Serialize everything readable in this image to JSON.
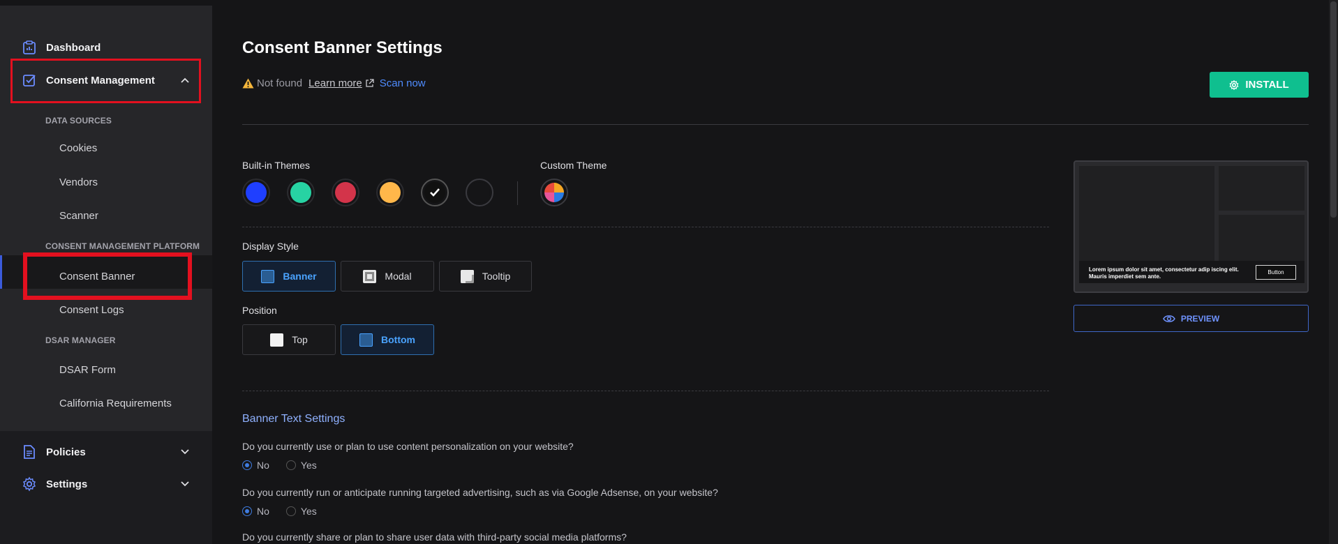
{
  "sidebar": {
    "dashboard": "Dashboard",
    "consent_management": "Consent Management",
    "data_sources_label": "DATA SOURCES",
    "cookies": "Cookies",
    "vendors": "Vendors",
    "scanner": "Scanner",
    "cmp_label": "CONSENT MANAGEMENT PLATFORM",
    "consent_banner": "Consent Banner",
    "consent_logs": "Consent Logs",
    "dsar_label": "DSAR MANAGER",
    "dsar_form": "DSAR Form",
    "california": "California Requirements",
    "policies": "Policies",
    "settings": "Settings"
  },
  "main": {
    "title": "Consent Banner Settings",
    "status_not_found": "Not found",
    "learn_more": "Learn more",
    "scan_now": "Scan now",
    "install": "INSTALL",
    "builtin_themes": "Built-in Themes",
    "custom_theme": "Custom Theme",
    "theme_colors": [
      "#1f3fff",
      "#27d3a3",
      "#d3344a",
      "#ffb74a",
      "#111111",
      "#151517"
    ],
    "display_style_label": "Display Style",
    "display_styles": [
      "Banner",
      "Modal",
      "Tooltip"
    ],
    "selected_display_style": "Banner",
    "position_label": "Position",
    "positions": [
      "Top",
      "Bottom"
    ],
    "selected_position": "Bottom",
    "preview_text": "Lorem ipsum dolor sit amet, consectetur adip iscing elit. Mauris imperdiet sem ante.",
    "preview_button": "Button",
    "preview_action": "PREVIEW",
    "banner_text_settings": "Banner Text Settings",
    "questions": [
      {
        "text": "Do you currently use or plan to use content personalization on your website?",
        "no": "No",
        "yes": "Yes",
        "selected": "No"
      },
      {
        "text": "Do you currently run or anticipate running targeted advertising, such as via Google Adsense, on your website?",
        "no": "No",
        "yes": "Yes",
        "selected": "No"
      },
      {
        "text": "Do you currently share or plan to share user data with third-party social media platforms?"
      }
    ]
  },
  "colors": {
    "accent_green": "#0fbf8f",
    "accent_blue": "#4aa3ff",
    "highlight_red": "#e3101f"
  }
}
